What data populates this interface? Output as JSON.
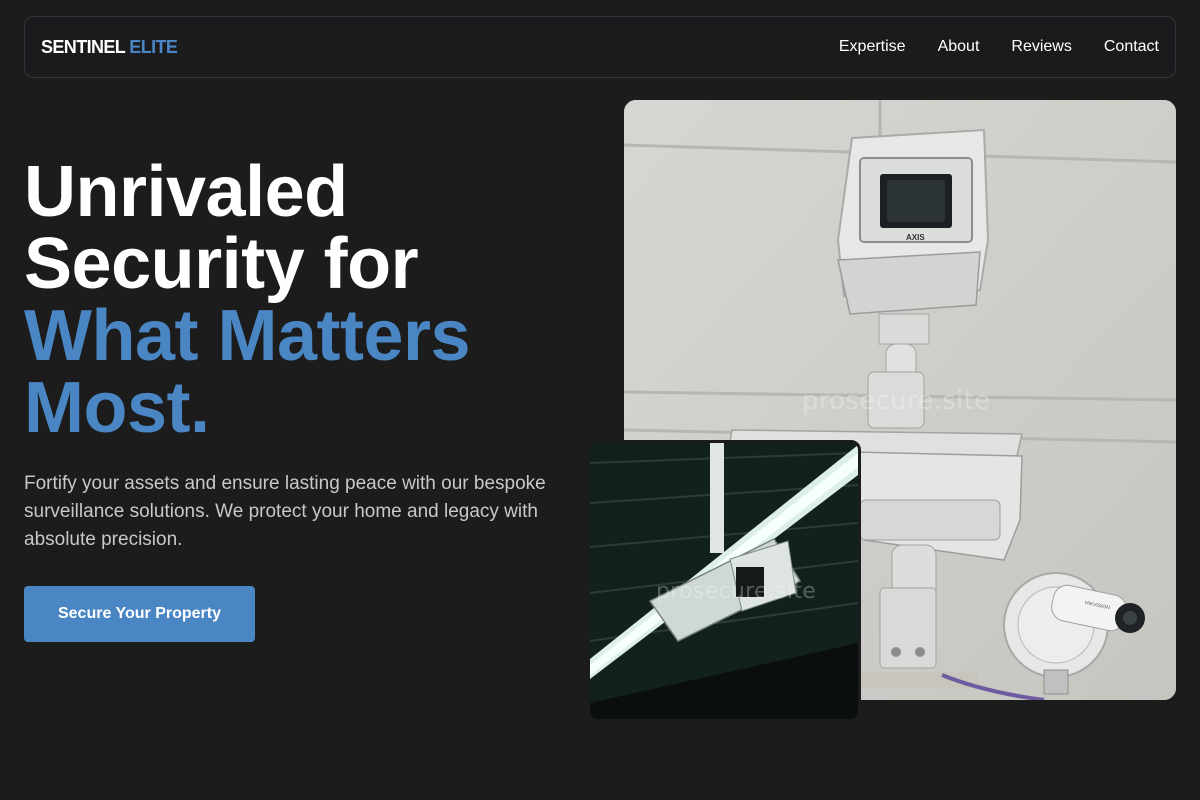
{
  "brand": {
    "part1": "SENTINEL",
    "part2": "ELITE"
  },
  "nav": [
    {
      "label": "Expertise"
    },
    {
      "label": "About"
    },
    {
      "label": "Reviews"
    },
    {
      "label": "Contact"
    }
  ],
  "hero": {
    "title_line1": "Unrivaled",
    "title_line2": "Security for",
    "title_accent1": "What Matters",
    "title_accent2": "Most.",
    "description": "Fortify your assets and ensure lasting peace with our bespoke surveillance solutions. We protect your home and legacy with absolute precision.",
    "cta_label": "Secure Your Property"
  },
  "images": {
    "main_watermark": "prosecure.site",
    "small_watermark": "prosecure.site",
    "main_camera_brand": "AXIS",
    "small_camera_brand": "HIKVISION"
  },
  "colors": {
    "background": "#1c1c1d",
    "accent": "#4a86c4",
    "text_muted": "#c8c8cc"
  }
}
